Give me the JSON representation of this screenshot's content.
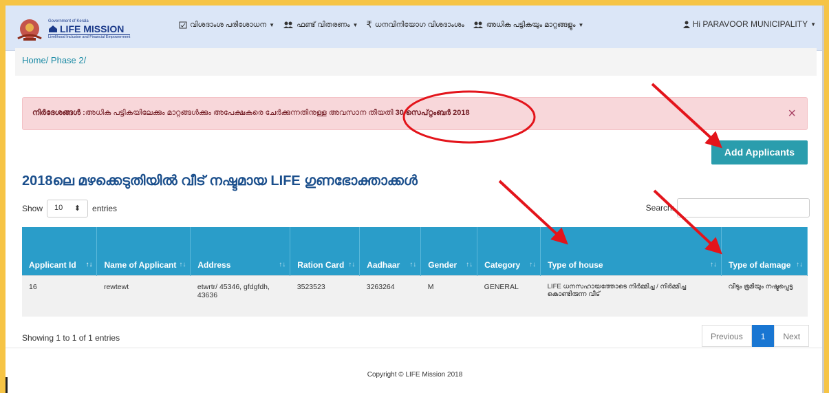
{
  "navbar": {
    "logo": {
      "gov": "Government of Kerala",
      "title": "LIFE MISSION",
      "tagline": "Livelihood Inclusion and Financial Empowerment"
    },
    "items": [
      {
        "label": "വിശദാംശ പരിശോധന",
        "icon": "checklist-icon",
        "has_caret": true
      },
      {
        "label": "ഫണ്ട് വിതരണം",
        "icon": "users-icon",
        "has_caret": true
      },
      {
        "label": "ധനവിനിയോഗ വിശദാംശം",
        "icon": "rupee-icon",
        "has_caret": false
      },
      {
        "label": "അധിക പട്ടികയും മാറ്റങ്ങളും",
        "icon": "users-icon",
        "has_caret": true
      }
    ],
    "user": "Hi PARAVOOR MUNICIPALITY"
  },
  "breadcrumb": {
    "home": "Home",
    "phase": "Phase 2"
  },
  "alert": {
    "label": "നിർദേശങ്ങൾ :",
    "text": "അധിക പട്ടികയിലേക്കും മാറ്റങ്ങൾക്കും അപേക്ഷകരെ ചേർക്കുന്നതിനുള്ള അവസാന തീയതി ",
    "date": "30 സെപ്റ്റംബർ 2018",
    "close": "×"
  },
  "add_button": "Add Applicants",
  "page_title": "2018ലെ മഴക്കെടുതിയിൽ വീട് നഷ്ടമായ LIFE ഗുണഭോക്താക്കൾ",
  "show": {
    "pre": "Show",
    "value": "10",
    "post": "entries"
  },
  "search": {
    "label": "Search:",
    "value": ""
  },
  "table": {
    "headers": [
      "Applicant Id",
      "Name of Applicant",
      "Address",
      "Ration Card",
      "Aadhaar",
      "Gender",
      "Category",
      "Type of house",
      "Type of damage"
    ],
    "rows": [
      [
        "16",
        "rewtewt",
        "etwrtr/ 45346, gfdgfdh, 43636",
        "3523523",
        "3263264",
        "M",
        "GENERAL",
        "LIFE ധനസഹായത്തോടെ നിർമ്മിച്ച / നിർമ്മിച്ച കൊണ്ടിരുന്ന വീട്",
        "വീടും ഭൂമിയും നഷ്ടപ്പെട്ട"
      ]
    ]
  },
  "info": "Showing 1 to 1 of 1 entries",
  "pager": {
    "prev": "Previous",
    "current": "1",
    "next": "Next"
  },
  "footer": "Copyright © LIFE Mission 2018",
  "colors": {
    "header": "#2a9dc9",
    "button": "#2a9dad",
    "alert_bg": "#f8d7da",
    "annotation": "#e3141b",
    "title": "#1b4f8c"
  }
}
